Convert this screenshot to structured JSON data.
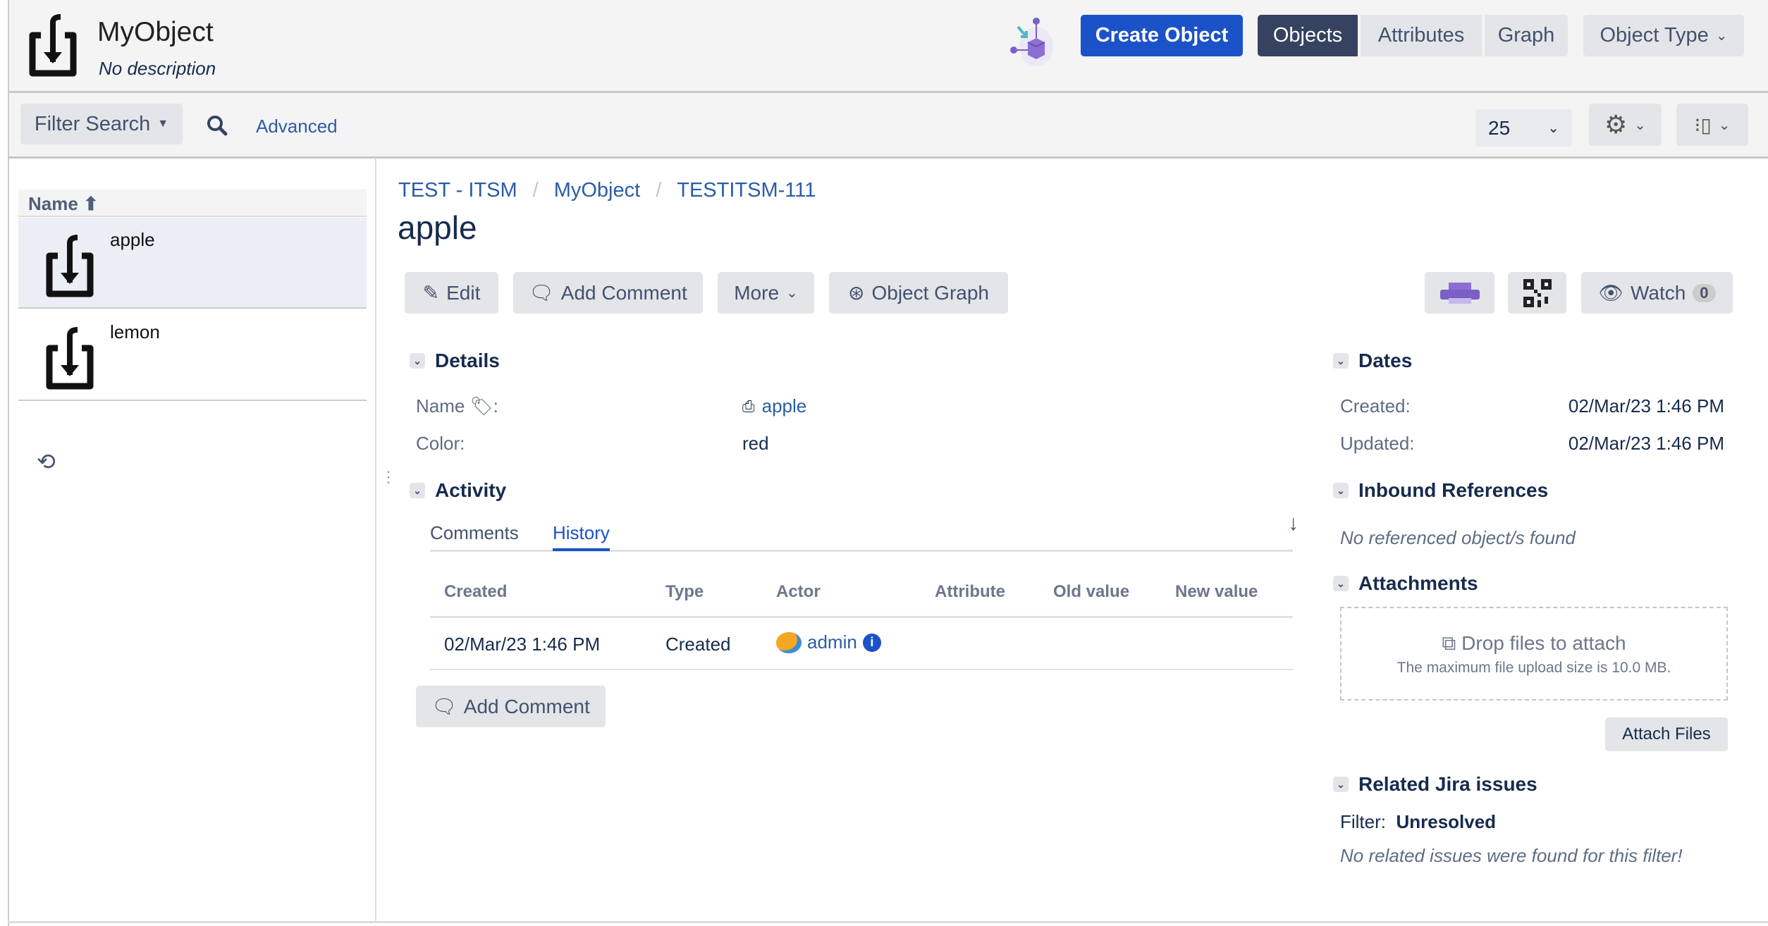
{
  "header": {
    "title": "MyObject",
    "description": "No description",
    "create_label": "Create Object",
    "nav": [
      "Objects",
      "Attributes",
      "Graph"
    ],
    "object_type_label": "Object Type"
  },
  "toolbar": {
    "filter_label": "Filter Search",
    "advanced_label": "Advanced",
    "page_size": "25"
  },
  "sidebar": {
    "column_header": "Name",
    "items": [
      {
        "label": "apple"
      },
      {
        "label": "lemon"
      }
    ]
  },
  "breadcrumb": [
    "TEST - ITSM",
    "MyObject",
    "TESTITSM-111"
  ],
  "object": {
    "title": "apple"
  },
  "actions": {
    "edit": "Edit",
    "add_comment": "Add Comment",
    "more": "More",
    "object_graph": "Object Graph",
    "watch": "Watch",
    "watch_count": "0"
  },
  "details": {
    "title": "Details",
    "rows": [
      {
        "label": "Name",
        "value": "apple"
      },
      {
        "label": "Color:",
        "value": "red"
      }
    ]
  },
  "activity": {
    "title": "Activity",
    "tabs": [
      "Comments",
      "History"
    ],
    "columns": [
      "Created",
      "Type",
      "Actor",
      "Attribute",
      "Old value",
      "New value"
    ],
    "rows": [
      {
        "created": "02/Mar/23 1:46 PM",
        "type": "Created",
        "actor": "admin"
      }
    ],
    "add_comment": "Add Comment"
  },
  "dates": {
    "title": "Dates",
    "created_label": "Created:",
    "created": "02/Mar/23 1:46 PM",
    "updated_label": "Updated:",
    "updated": "02/Mar/23 1:46 PM"
  },
  "inbound": {
    "title": "Inbound References",
    "empty": "No referenced object/s found"
  },
  "attachments": {
    "title": "Attachments",
    "drop": "Drop files to attach",
    "limit": "The maximum file upload size is 10.0 MB.",
    "attach_button": "Attach Files"
  },
  "related": {
    "title": "Related Jira issues",
    "filter_label": "Filter:",
    "filter_value": "Unresolved",
    "empty": "No related issues were found for this filter!"
  },
  "colors": {
    "primary": "#1c52c8",
    "nav_active": "#354360",
    "link": "#2a5ca8"
  }
}
